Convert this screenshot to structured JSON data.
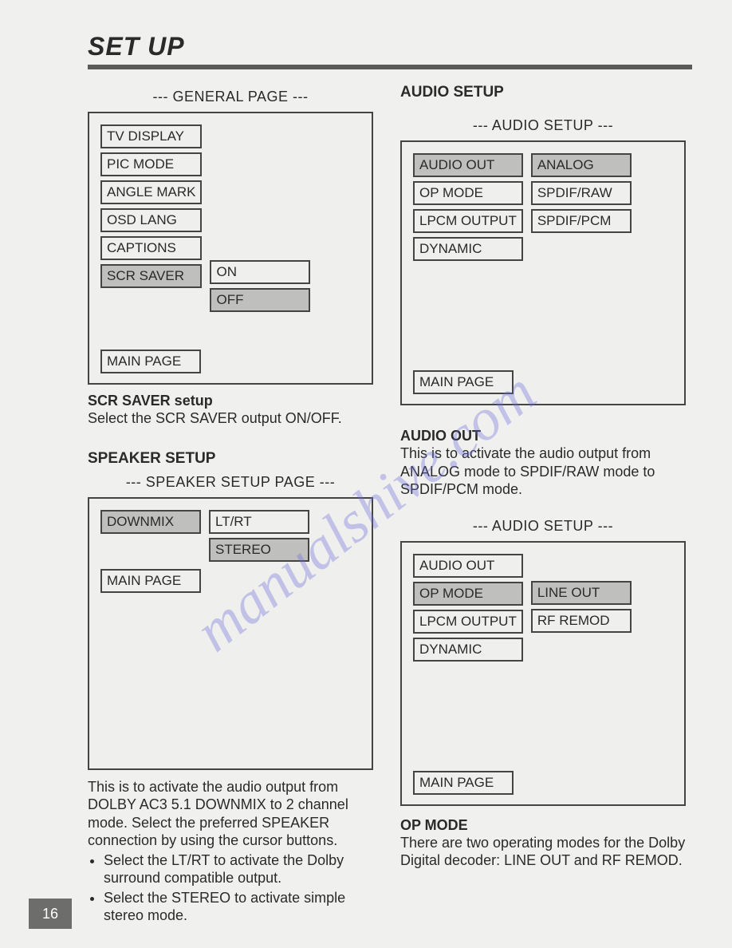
{
  "title": "SET UP",
  "page_number": "16",
  "watermark": "manualshive.com",
  "left": {
    "general": {
      "panel_label": "--- GENERAL PAGE ---",
      "items": [
        "TV DISPLAY",
        "PIC MODE",
        "ANGLE MARK",
        "OSD LANG",
        "CAPTIONS",
        "SCR SAVER"
      ],
      "selected": "SCR SAVER",
      "options": [
        "ON",
        "OFF"
      ],
      "option_selected": "OFF",
      "main_page": "MAIN PAGE",
      "sub_heading": "SCR SAVER setup",
      "sub_text": "Select the SCR SAVER output ON/OFF."
    },
    "speaker": {
      "heading": "SPEAKER SETUP",
      "panel_label": "--- SPEAKER SETUP PAGE ---",
      "items": [
        "DOWNMIX"
      ],
      "selected": "DOWNMIX",
      "options": [
        "LT/RT",
        "STEREO"
      ],
      "option_selected": "STEREO",
      "main_page": "MAIN PAGE",
      "text": "This is to activate the audio output from DOLBY AC3 5.1 DOWNMIX to 2 channel mode.  Select the preferred SPEAKER connection by using the cursor buttons.",
      "bullets": [
        "Select the LT/RT to activate the Dolby surround compatible output.",
        "Select the STEREO to activate simple stereo mode."
      ]
    }
  },
  "right": {
    "audio_heading": "AUDIO SETUP",
    "audio1": {
      "panel_label": "--- AUDIO SETUP ---",
      "items": [
        "AUDIO OUT",
        "OP MODE",
        "LPCM OUTPUT",
        "DYNAMIC"
      ],
      "selected": "AUDIO OUT",
      "options": [
        "ANALOG",
        "SPDIF/RAW",
        "SPDIF/PCM"
      ],
      "option_selected": "ANALOG",
      "main_page": "MAIN PAGE",
      "sub_heading": "AUDIO OUT",
      "sub_text": "This is to activate the audio output from ANALOG mode to SPDIF/RAW mode to SPDIF/PCM mode."
    },
    "audio2": {
      "panel_label": "--- AUDIO SETUP ---",
      "items": [
        "AUDIO OUT",
        "OP MODE",
        "LPCM OUTPUT",
        "DYNAMIC"
      ],
      "selected": "OP MODE",
      "options": [
        "LINE OUT",
        "RF REMOD"
      ],
      "option_selected": "LINE OUT",
      "main_page": "MAIN PAGE",
      "sub_heading": "OP MODE",
      "sub_text": "There are two operating modes for the Dolby Digital decoder:  LINE OUT and RF REMOD."
    }
  }
}
